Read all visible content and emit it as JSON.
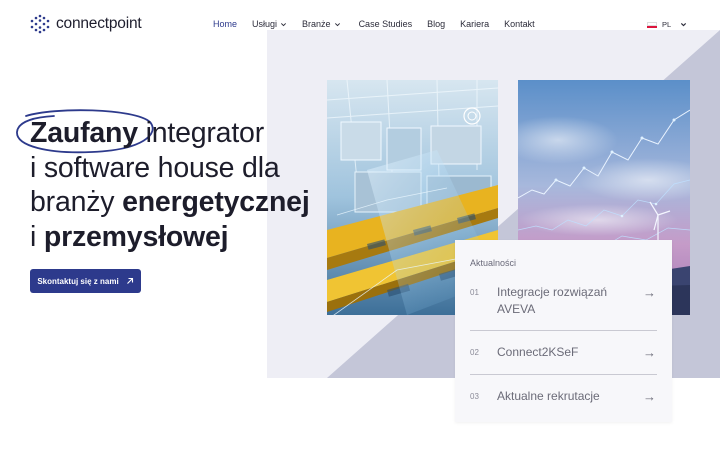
{
  "header": {
    "logo_text": "connectpoint",
    "nav": [
      {
        "label": "Home",
        "active": true,
        "dropdown": false
      },
      {
        "label": "Usługi",
        "active": false,
        "dropdown": true
      },
      {
        "label": "Branże",
        "active": false,
        "dropdown": true
      },
      {
        "label": "Case Studies",
        "active": false,
        "dropdown": false
      },
      {
        "label": "Blog",
        "active": false,
        "dropdown": false
      },
      {
        "label": "Kariera",
        "active": false,
        "dropdown": false
      },
      {
        "label": "Kontakt",
        "active": false,
        "dropdown": false
      }
    ],
    "language": "PL"
  },
  "hero": {
    "word_highlight": "Zaufany",
    "line1_rest": " integrator",
    "line2": "i software house dla",
    "line3_prefix": "branży ",
    "line3_bold": "energetycznej",
    "line4_prefix": "i ",
    "line4_bold": "przemysłowej",
    "cta_label": "Skontaktuj się z nami"
  },
  "news": {
    "title": "Aktualności",
    "items": [
      {
        "num": "01",
        "text": "Integracje rozwiązań AVEVA"
      },
      {
        "num": "02",
        "text": "Connect2KSeF"
      },
      {
        "num": "03",
        "text": "Aktualne rekrutacje"
      }
    ]
  },
  "colors": {
    "accent": "#2d3a8c",
    "panel": "#eeeef5",
    "panel_dark": "#c4c6d8"
  },
  "icons": {
    "logo": "dot-grid-logo-icon",
    "cta_arrow": "arrow-up-right-icon",
    "news_arrow": "arrow-right-icon",
    "flag": "poland-flag-icon"
  }
}
